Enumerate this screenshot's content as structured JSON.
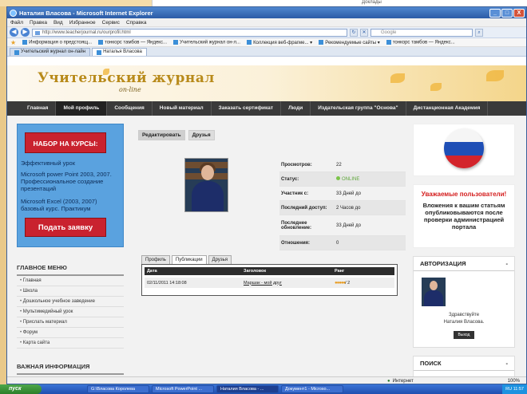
{
  "background_doc_text": "Доклады",
  "window": {
    "title": "Наталия Власова - Microsoft Internet Explorer",
    "controls": [
      "_",
      "□",
      "X"
    ]
  },
  "menu": [
    "Файл",
    "Правка",
    "Вид",
    "Избранное",
    "Сервис",
    "Справка"
  ],
  "address": {
    "url": "http://www.teacherjournal.ru/ourprofil.html",
    "search_placeholder": "Google"
  },
  "favorites": [
    "Избранное",
    "Информация о предстоящ...",
    "тонкорс тамбов — Яндекс...",
    "Учительский журнал он-л...",
    "Коллекция веб-фрагме... ▾",
    "Рекомендуемые сайты ▾",
    "тонкорс тамбов — Яндекс..."
  ],
  "browser_tabs": [
    "Учительский журнал он-лайн",
    "Наталья Власова"
  ],
  "site": {
    "logo": "Учительский журнал",
    "logo_sub": "on-line",
    "nav": [
      "Главная",
      "Мой профиль",
      "Сообщения",
      "Новый материал",
      "Заказать сертификат",
      "Люди",
      "Издательская группа \"Основа\"",
      "Дистанционная Академия"
    ],
    "promo": {
      "title": "НАБОР НА КУРСЫ:",
      "l1": "Эффективный урок",
      "l2": "Microsoft power Point 2003, 2007. Профессиональное создание презентаций",
      "l3": "Microsoft Excel (2003, 2007) базовый курс. Практикум",
      "button": "Подать заявку"
    },
    "main_menu_title": "ГЛАВНОЕ МЕНЮ",
    "main_menu": [
      "Главная",
      "Школа",
      "Дошкольное учебное заведение",
      "Мультимедийный урок",
      "Прислать материал",
      "Форум",
      "Карта сайта"
    ],
    "important_title": "ВАЖНАЯ ИНФОРМАЦИЯ",
    "profile_tabs": [
      "Редактировать",
      "Друзья"
    ],
    "info": [
      {
        "k": "Просмотров:",
        "v": "22"
      },
      {
        "k": "Статус:",
        "v": "ONLINE"
      },
      {
        "k": "Участник с:",
        "v": "33 Дней до"
      },
      {
        "k": "Последний доступ:",
        "v": "2 Часов до"
      },
      {
        "k": "Последнее обновление:",
        "v": "33 Дней до"
      },
      {
        "k": "Отношения:",
        "v": "0"
      }
    ],
    "pub_tabs": [
      "Профиль",
      "Публикации",
      "Друзья"
    ],
    "pub_table": {
      "headers": [
        "Дата",
        "Заголовок",
        "Ранг"
      ],
      "row": {
        "date": "02/11/2011 14:18:08",
        "title": "Маршак - мой друг",
        "rank": "/ 2"
      }
    },
    "right": {
      "msg_title": "Уважаемые пользователи!",
      "msg_text": "Вложения к вашим статьям опубликовываются после проверки администрацией портала",
      "auth_title": "АВТОРИЗАЦИЯ",
      "greeting": "Здравствуйте",
      "user": "Наталия Власова.",
      "logout": "Выход",
      "search_title": "ПОИСК"
    }
  },
  "status": {
    "zone": "Интернет",
    "zoom": "100%"
  },
  "taskbar": {
    "start": "пуск",
    "tasks": [
      "G:\\Власова Королева",
      "Microsoft PowerPoint ...",
      "Наталия Власова - ...",
      "Документ1 - Microso..."
    ],
    "lang": "RU",
    "time": "11:57"
  },
  "colors": {
    "nav_bg": "#3a3a3a",
    "promo_bg": "#5aa2df",
    "promo_button": "#c9222f",
    "accent_red": "#d41e1e"
  }
}
